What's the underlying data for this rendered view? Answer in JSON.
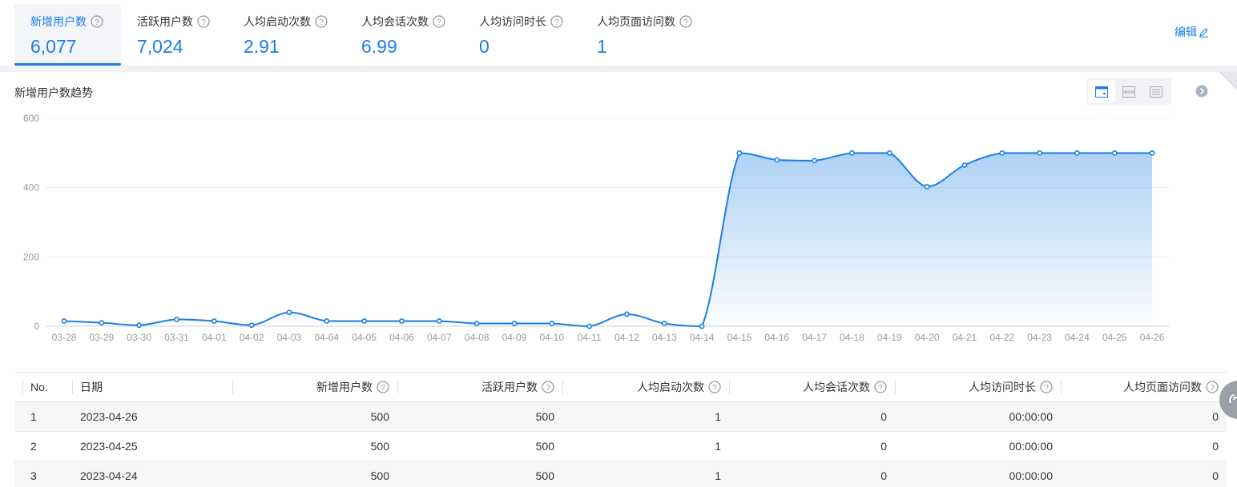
{
  "metrics": [
    {
      "label": "新增用户数",
      "value": "6,077",
      "active": true
    },
    {
      "label": "活跃用户数",
      "value": "7,024",
      "active": false
    },
    {
      "label": "人均启动次数",
      "value": "2.91",
      "active": false
    },
    {
      "label": "人均会话次数",
      "value": "6.99",
      "active": false
    },
    {
      "label": "人均访问时长",
      "value": "0",
      "active": false
    },
    {
      "label": "人均页面访问数",
      "value": "1",
      "active": false
    }
  ],
  "edit_label": "编辑",
  "chart_panel": {
    "title": "新增用户数趋势",
    "views": [
      "card-view-icon",
      "split-view-icon",
      "list-view-icon"
    ]
  },
  "chart_data": {
    "type": "area",
    "title": "新增用户数趋势",
    "x": [
      "03-28",
      "03-29",
      "03-30",
      "03-31",
      "04-01",
      "04-02",
      "04-03",
      "04-04",
      "04-05",
      "04-06",
      "04-07",
      "04-08",
      "04-09",
      "04-10",
      "04-11",
      "04-12",
      "04-13",
      "04-14",
      "04-15",
      "04-16",
      "04-17",
      "04-18",
      "04-19",
      "04-20",
      "04-21",
      "04-22",
      "04-23",
      "04-24",
      "04-25",
      "04-26"
    ],
    "series": [
      {
        "values": [
          15,
          10,
          3,
          20,
          15,
          3,
          40,
          15,
          15,
          15,
          15,
          8,
          8,
          8,
          0,
          35,
          8,
          0,
          500,
          480,
          478,
          500,
          500,
          403,
          465,
          500,
          500,
          500,
          500,
          500
        ]
      }
    ],
    "yticks": [
      0,
      200,
      400,
      600
    ],
    "ylim": [
      0,
      600
    ],
    "grid": true,
    "color": "#1a7ee6"
  },
  "table": {
    "headers": [
      "No.",
      "日期",
      "新增用户数",
      "活跃用户数",
      "人均启动次数",
      "人均会话次数",
      "人均访问时长",
      "人均页面访问数"
    ],
    "rows": [
      [
        "1",
        "2023-04-26",
        "500",
        "500",
        "1",
        "0",
        "00:00:00",
        "0"
      ],
      [
        "2",
        "2023-04-25",
        "500",
        "500",
        "1",
        "0",
        "00:00:00",
        "0"
      ],
      [
        "3",
        "2023-04-24",
        "500",
        "500",
        "1",
        "0",
        "00:00:00",
        "0"
      ]
    ]
  },
  "colors": {
    "accent": "#1a7ee6",
    "band": "#f0f2f5"
  }
}
